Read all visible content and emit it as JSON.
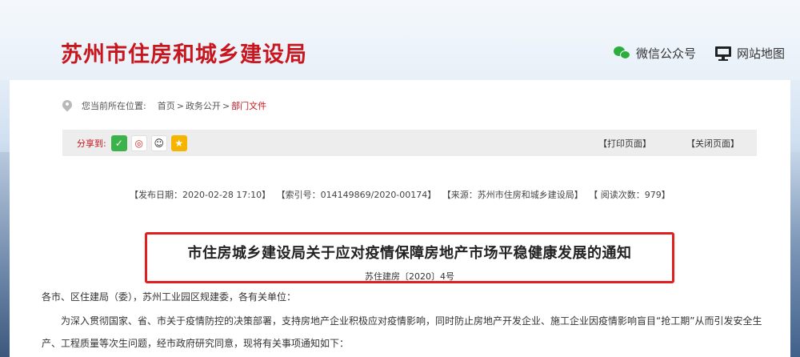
{
  "header": {
    "site_title": "苏州市住房和城乡建设局",
    "wechat_label": "微信公众号",
    "sitemap_label": "网站地图"
  },
  "breadcrumb": {
    "prefix": "您当前所在位置:",
    "items": [
      "首页",
      "政务公开",
      "部门文件"
    ],
    "separator": ">"
  },
  "share": {
    "label": "分享到:",
    "icons": [
      "wechat-icon",
      "weibo-icon",
      "qq-icon",
      "qzone-icon"
    ],
    "print_label": "【打印页面】",
    "close_label": "【关闭页面】"
  },
  "meta": {
    "publish_date": "【发布日期：2020-02-28 17:10】",
    "index_no": "【索引号：014149869/2020-00174】",
    "source": "【来源：苏州市住房和城乡建设局】",
    "views": "【 阅读次数：979】"
  },
  "article": {
    "title": "市住房城乡建设局关于应对疫情保障房地产市场平稳健康发展的通知",
    "doc_number": "苏住建房〔2020〕4号",
    "greeting": "各市、区住建局（委），苏州工业园区规建委，各有关单位：",
    "paragraph1": "为深入贯彻国家、省、市关于疫情防控的决策部署，支持房地产企业积极应对疫情影响，同时防止房地产开发企业、施工企业因疫情影响盲目“抢工期”从而引发安全生产、工程质量等次生问题，经市政府研究同意，现将有关事项通知如下："
  },
  "colors": {
    "brand_red": "#c8161e",
    "highlight_border": "#e02020",
    "share_bar": "#ededed"
  }
}
